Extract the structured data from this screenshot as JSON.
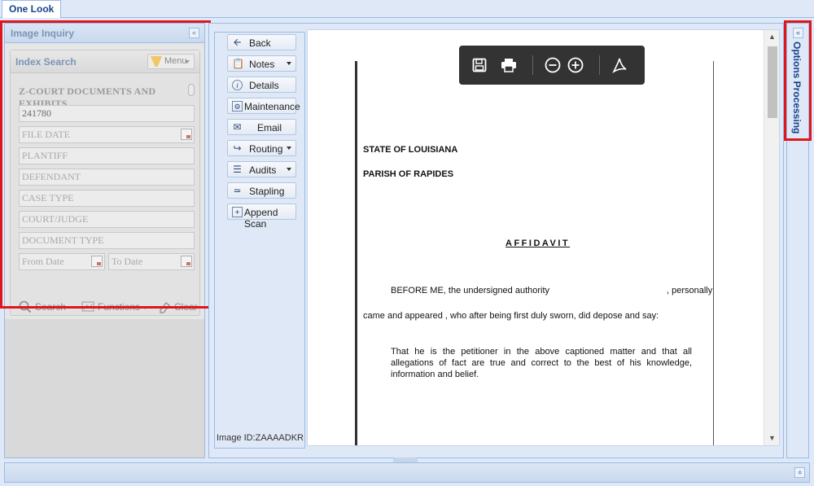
{
  "app": {
    "tab": "One Look"
  },
  "left_panel": {
    "title": "Image Inquiry",
    "collapse_icon": "«",
    "index_search": {
      "title": "Index Search",
      "menu_label": "Menu",
      "document_type": "Z-COURT DOCUMENTS AND EXHIBITS",
      "fields": {
        "case_number": "241780",
        "file_date": "FILE DATE",
        "plantiff": "PLANTIFF",
        "defendant": "DEFENDANT",
        "case_type": "CASE TYPE",
        "court_judge": "COURT/JUDGE",
        "document_type": "DOCUMENT TYPE",
        "from_date": "From Date",
        "to_date": "To Date"
      },
      "actions": {
        "search": "Search",
        "functions": "Functions",
        "clear": "Clear"
      }
    }
  },
  "actions": [
    {
      "label": "Back",
      "icon": "back-arrow-icon",
      "dropdown": false
    },
    {
      "label": "Notes",
      "icon": "clipboard-icon",
      "dropdown": true
    },
    {
      "label": "Details",
      "icon": "info-icon",
      "dropdown": false
    },
    {
      "label": "Maintenance",
      "icon": "maintenance-icon",
      "dropdown": false
    },
    {
      "label": "Email",
      "icon": "envelope-icon",
      "dropdown": false
    },
    {
      "label": "Routing",
      "icon": "routing-icon",
      "dropdown": true
    },
    {
      "label": "Audits",
      "icon": "audit-icon",
      "dropdown": true
    },
    {
      "label": "Stapling",
      "icon": "staple-icon",
      "dropdown": false
    },
    {
      "label": "Append Scan",
      "icon": "append-scan-icon",
      "dropdown": false
    }
  ],
  "image_id": "Image ID:ZAAAADKR",
  "document": {
    "state": "STATE OF LOUISIANA",
    "parish": "PARISH OF RAPIDES",
    "heading": "AFFIDAVIT",
    "before": "BEFORE ME, the undersigned authority",
    "personally": ", personally",
    "came": "came and appeared , who after being first duly sworn, did depose and say:",
    "that": "That he is the petitioner in the above captioned matter and that all allegations of fact are true and correct to the best of his knowledge, information and belief."
  },
  "viewer_toolbar": [
    "save-icon",
    "print-icon",
    "zoom-out-icon",
    "zoom-in-icon",
    "pdf-icon"
  ],
  "right_panel": {
    "title": "Options Processing",
    "expand_icon": "«"
  },
  "bottom_panel": {
    "expand_icon": "»"
  },
  "colors": {
    "accent": "#15428b",
    "highlight": "#e0161d",
    "panel_bg": "#dfe8f6",
    "border": "#99bbe8"
  }
}
